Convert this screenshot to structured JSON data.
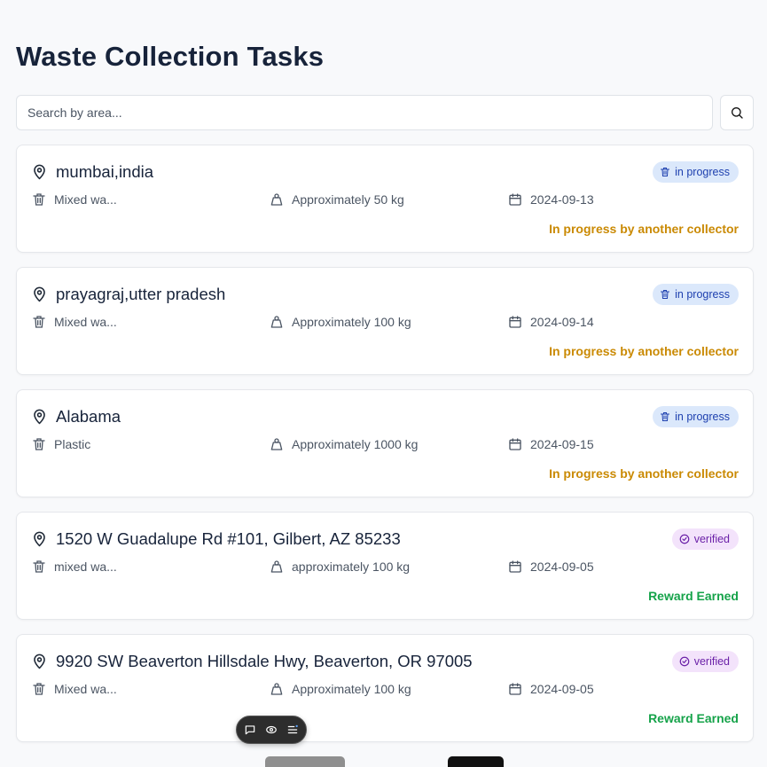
{
  "page": {
    "title": "Waste Collection Tasks"
  },
  "search": {
    "placeholder": "Search by area..."
  },
  "tasks": [
    {
      "location": "mumbai,india",
      "badge": "in progress",
      "badge_kind": "in-progress",
      "waste_type": "Mixed wa...",
      "amount": "Approximately 50 kg",
      "date": "2024-09-13",
      "status": "In progress by another collector",
      "status_kind": "progress"
    },
    {
      "location": "prayagraj,utter pradesh",
      "badge": "in progress",
      "badge_kind": "in-progress",
      "waste_type": "Mixed wa...",
      "amount": "Approximately 100 kg",
      "date": "2024-09-14",
      "status": "In progress by another collector",
      "status_kind": "progress"
    },
    {
      "location": "Alabama",
      "badge": "in progress",
      "badge_kind": "in-progress",
      "waste_type": "Plastic",
      "amount": "Approximately 1000 kg",
      "date": "2024-09-15",
      "status": "In progress by another collector",
      "status_kind": "progress"
    },
    {
      "location": "1520 W Guadalupe Rd #101, Gilbert, AZ 85233",
      "badge": "verified",
      "badge_kind": "verified",
      "waste_type": "mixed wa...",
      "amount": "approximately 100 kg",
      "date": "2024-09-05",
      "status": "Reward Earned",
      "status_kind": "earned"
    },
    {
      "location": "9920 SW Beaverton Hillsdale Hwy, Beaverton, OR 97005",
      "badge": "verified",
      "badge_kind": "verified",
      "waste_type": "Mixed wa...",
      "amount": "Approximately 100 kg",
      "date": "2024-09-05",
      "status": "Reward Earned",
      "status_kind": "earned"
    }
  ],
  "icons": {
    "location": "map-pin-icon",
    "waste_type": "trash-icon",
    "amount": "weight-icon",
    "date": "calendar-icon",
    "in_progress": "trash-icon",
    "verified": "check-circle-icon",
    "search": "search-icon"
  },
  "colors": {
    "in_progress_badge_bg": "#dbe8fb",
    "in_progress_badge_text": "#1e40af",
    "verified_badge_bg": "#f3e3fb",
    "verified_badge_text": "#6b21a8",
    "status_progress": "#ca8a04",
    "status_earned": "#16a34a"
  }
}
